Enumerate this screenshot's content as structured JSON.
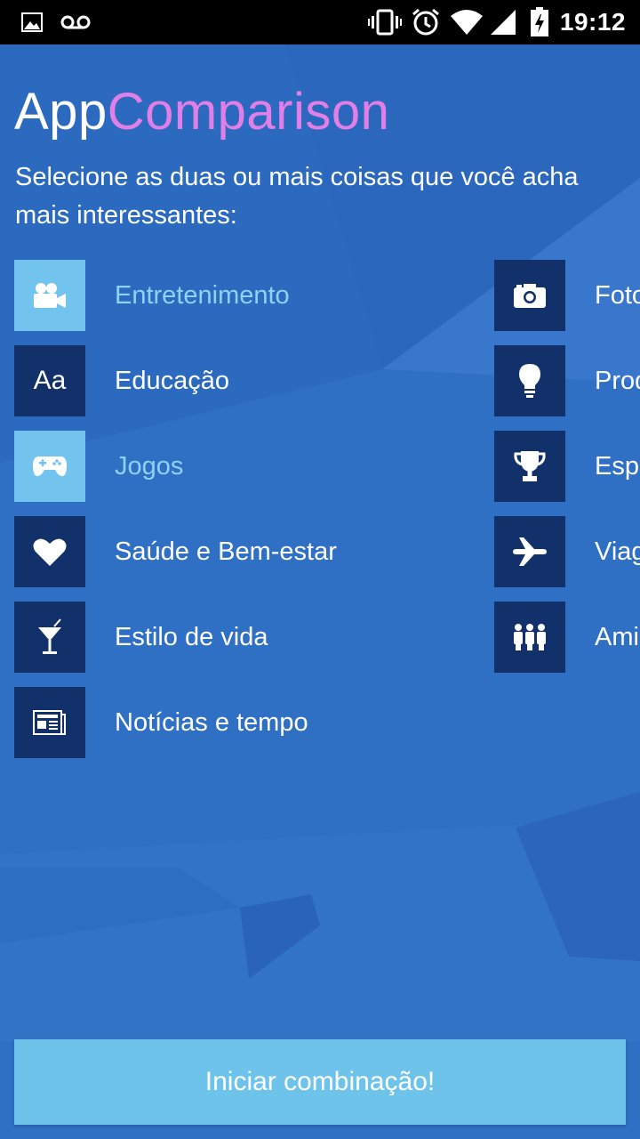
{
  "status_bar": {
    "time": "19:12",
    "icons": [
      "image-icon",
      "voicemail-icon",
      "vibrate-icon",
      "alarm-icon",
      "wifi-icon",
      "signal-icon",
      "battery-charging-icon"
    ]
  },
  "header": {
    "title_prefix": "App",
    "title_accent": "Comparison",
    "subtitle": "Selecione as duas ou mais coisas que você acha mais interessantes:"
  },
  "categories_left": [
    {
      "label": "Entretenimento",
      "icon": "video-camera-icon",
      "selected": true
    },
    {
      "label": "Educação",
      "icon": "font-aa-icon",
      "selected": false
    },
    {
      "label": "Jogos",
      "icon": "gamepad-icon",
      "selected": true
    },
    {
      "label": "Saúde e Bem-estar",
      "icon": "heart-icon",
      "selected": false
    },
    {
      "label": "Estilo de vida",
      "icon": "cocktail-icon",
      "selected": false
    },
    {
      "label": "Notícias e tempo",
      "icon": "newspaper-icon",
      "selected": false
    }
  ],
  "categories_right": [
    {
      "label": "Foto",
      "icon": "camera-icon",
      "selected": false
    },
    {
      "label": "Prod",
      "icon": "lightbulb-icon",
      "selected": false
    },
    {
      "label": "Espo",
      "icon": "trophy-icon",
      "selected": false
    },
    {
      "label": "Viag",
      "icon": "airplane-icon",
      "selected": false
    },
    {
      "label": "Ami",
      "icon": "people-icon",
      "selected": false
    }
  ],
  "icon_text": {
    "font_aa": "Aa"
  },
  "start_button": {
    "label": "Iniciar combinação!"
  },
  "colors": {
    "background": "#2f6fc4",
    "tile": "#12306a",
    "tile_selected": "#72c4ee",
    "accent": "#e27fe6",
    "button": "#6ec3ea"
  }
}
